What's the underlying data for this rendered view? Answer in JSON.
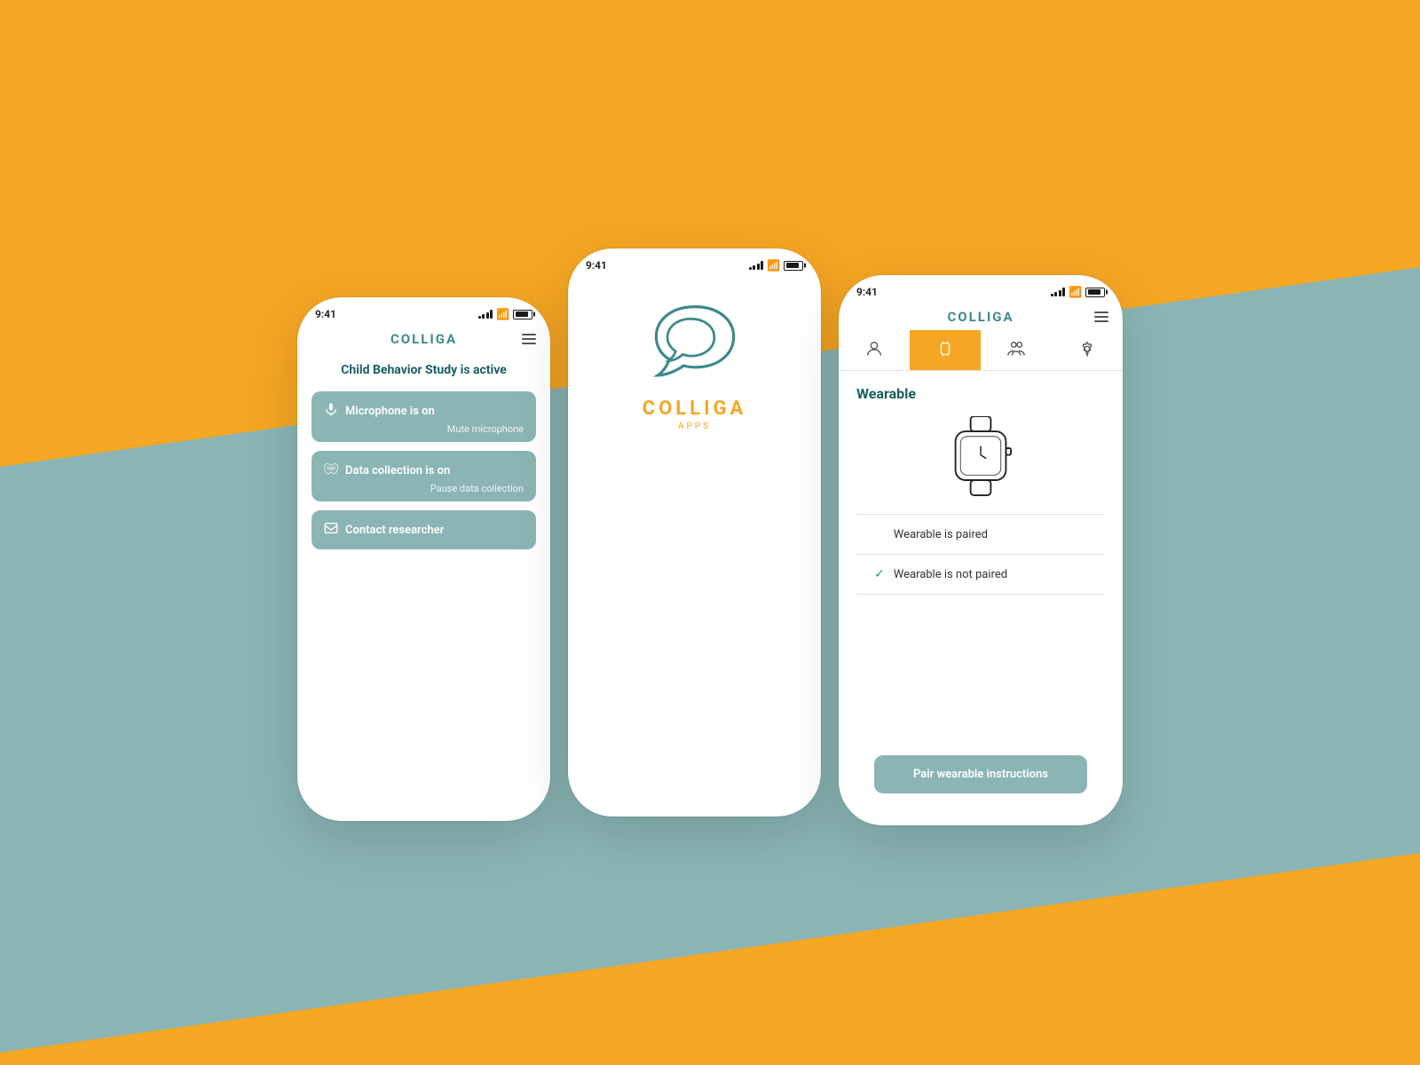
{
  "background": {
    "top_color": "#F5A623",
    "bottom_color": "#8BB5B5"
  },
  "phone_left": {
    "status_time": "9:41",
    "app_title": "COLLIGA",
    "menu_label": "☰",
    "study_title": "Child Behavior Study is active",
    "buttons": [
      {
        "id": "microphone",
        "label": "Microphone is on",
        "sub": "Mute microphone",
        "icon": "microphone"
      },
      {
        "id": "data-collection",
        "label": "Data collection is on",
        "sub": "Pause data collection",
        "icon": "wifi"
      },
      {
        "id": "contact",
        "label": "Contact researcher",
        "sub": "",
        "icon": "mail"
      }
    ]
  },
  "phone_center": {
    "status_time": "9:41",
    "splash_logo_color": "#3D8A8A",
    "app_name": "COLLIGA",
    "app_sub": "APPS"
  },
  "phone_right": {
    "status_time": "9:41",
    "app_title": "COLLIGA",
    "tabs": [
      {
        "id": "profile",
        "icon": "person",
        "active": false
      },
      {
        "id": "wearable",
        "icon": "watch",
        "active": true
      },
      {
        "id": "group",
        "icon": "group",
        "active": false
      },
      {
        "id": "settings",
        "icon": "settings",
        "active": false
      }
    ],
    "wearable_title": "Wearable",
    "options": [
      {
        "label": "Wearable is paired",
        "checked": false
      },
      {
        "label": "Wearable is not paired",
        "checked": true
      }
    ],
    "pair_button": "Pair wearable instructions"
  }
}
